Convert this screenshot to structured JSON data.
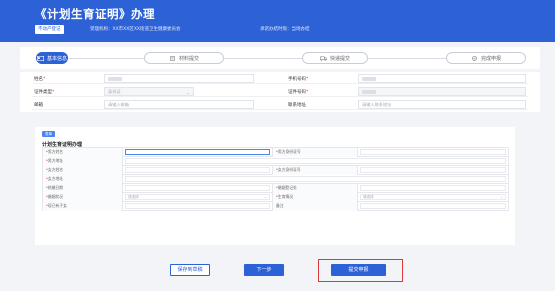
{
  "header": {
    "title": "《计划生育证明》办理",
    "tag": "不动产登记",
    "agency": "受理机构：XX市XX区XX街道卫生健康委员会",
    "time_limit": "承诺办结时限：当场办结"
  },
  "steps": [
    {
      "label": "基本信息",
      "icon": "id-card-icon",
      "active": true
    },
    {
      "label": "材料提交",
      "icon": "document-icon",
      "active": false
    },
    {
      "label": "快递提交",
      "icon": "truck-icon",
      "active": false
    },
    {
      "label": "完成申报",
      "icon": "check-circle-icon",
      "active": false
    }
  ],
  "basic_info": {
    "name_label": "姓名",
    "phone_label": "手机号码",
    "id_type_label": "证件类型",
    "id_type_value": "身份证",
    "id_number_label": "证件号码",
    "email_label": "邮箱",
    "email_placeholder": "请输入邮箱",
    "address_label": "联系地址",
    "address_placeholder": "请输入联系地址"
  },
  "form": {
    "tag": "表单",
    "title": "计划生育证明办理",
    "select_placeholder": "请选择",
    "rows": [
      {
        "left_label": "男方姓名",
        "right_label": "男方身份证号",
        "left_focus": true
      },
      {
        "left_label": "男方地址",
        "full": true
      },
      {
        "left_label": "女方姓名",
        "right_label": "女方身份证号"
      },
      {
        "left_label": "女方地址",
        "full": true
      },
      {
        "left_label": "结婚日期",
        "right_label": "婚姻登记处"
      },
      {
        "left_label": "婚姻状况",
        "right_label": "生育情况",
        "left_select": true,
        "right_select": true
      },
      {
        "left_label": "现已有子女",
        "right_label": "备注",
        "right_required": false
      }
    ]
  },
  "buttons": {
    "save_draft": "保存到草稿",
    "next": "下一步",
    "submit": "提交申报"
  },
  "colors": {
    "primary": "#2d62d6",
    "highlight_frame": "#d93a3a"
  }
}
